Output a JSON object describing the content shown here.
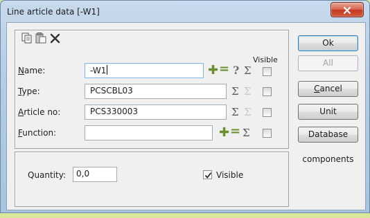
{
  "window": {
    "title": "Line article data [-W1]"
  },
  "toolbar": {
    "icons": [
      "copy-icon",
      "paste-icon",
      "delete-icon"
    ]
  },
  "columns": {
    "visible_header": "Visible"
  },
  "rows": [
    {
      "label_ul": "N",
      "label_rest": "ame:",
      "value": "-W1"
    },
    {
      "label_ul": "T",
      "label_rest": "ype:",
      "value": "PCSCBL03"
    },
    {
      "label_ul": "A",
      "label_rest": "rticle no:",
      "value": "PCS330003"
    },
    {
      "label_ul": "F",
      "label_rest": "unction:",
      "value": ""
    }
  ],
  "buttons": {
    "ok": "Ok",
    "all": "All",
    "cancel_ul": "C",
    "cancel_rest": "ancel",
    "unit": "Unit",
    "database": "Database"
  },
  "side_text": "components",
  "quantity": {
    "label": "Quantity:",
    "value": "0,0"
  },
  "visible_checkbox": {
    "label": "Visible",
    "checked": true
  },
  "colors": {
    "background": "#d9e79b",
    "accent": "#3c7fb1",
    "close": "#c33a22"
  }
}
